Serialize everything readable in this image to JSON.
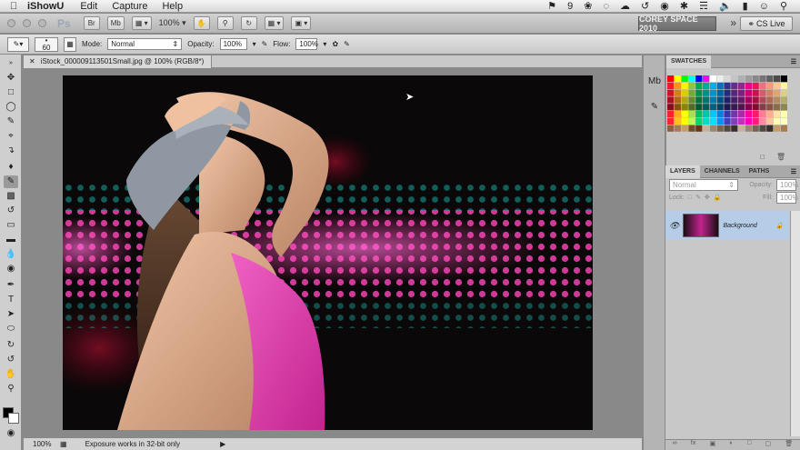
{
  "menubar": {
    "app_name": "iShowU",
    "items": [
      "Edit",
      "Capture",
      "Help"
    ],
    "battery": "9"
  },
  "appbar": {
    "logo": "Ps",
    "zoom": "100%",
    "workspace": "COREY SPACE 2010",
    "cs_live": "CS Live"
  },
  "options": {
    "brush_size": "60",
    "mode_label": "Mode:",
    "mode_value": "Normal",
    "opacity_label": "Opacity:",
    "opacity_value": "100%",
    "flow_label": "Flow:",
    "flow_value": "100%"
  },
  "document": {
    "tab_title": "iStock_000009113501Small.jpg @ 100% (RGB/8*)",
    "zoom": "100%",
    "status_message": "Exposure works in 32-bit only"
  },
  "swatches": {
    "title": "SWATCHES",
    "colors_row1": [
      "#ff0000",
      "#ffff00",
      "#00ff00",
      "#00ffff",
      "#0000ff",
      "#ff00ff",
      "#ffffff",
      "#ececec",
      "#d8d8d8",
      "#c4c4c4",
      "#b0b0b0",
      "#9c9c9c",
      "#888888",
      "#747474",
      "#606060",
      "#4c4c4c",
      "#000000"
    ],
    "colors": [
      "#ed1c24",
      "#f7941d",
      "#fff200",
      "#8dc63f",
      "#00a651",
      "#00a99d",
      "#00aeef",
      "#0072bc",
      "#2e3192",
      "#662d91",
      "#92278f",
      "#ec008c",
      "#ed145b",
      "#f26d7d",
      "#f7977a",
      "#fdc68a",
      "#fff799"
    ]
  },
  "layers": {
    "tabs": [
      "LAYERS",
      "CHANNELS",
      "PATHS"
    ],
    "blend_mode": "Normal",
    "opacity_label": "Opacity:",
    "opacity_value": "100%",
    "lock_label": "Lock:",
    "fill_label": "Fill:",
    "fill_value": "100%",
    "layer_name": "Background"
  }
}
